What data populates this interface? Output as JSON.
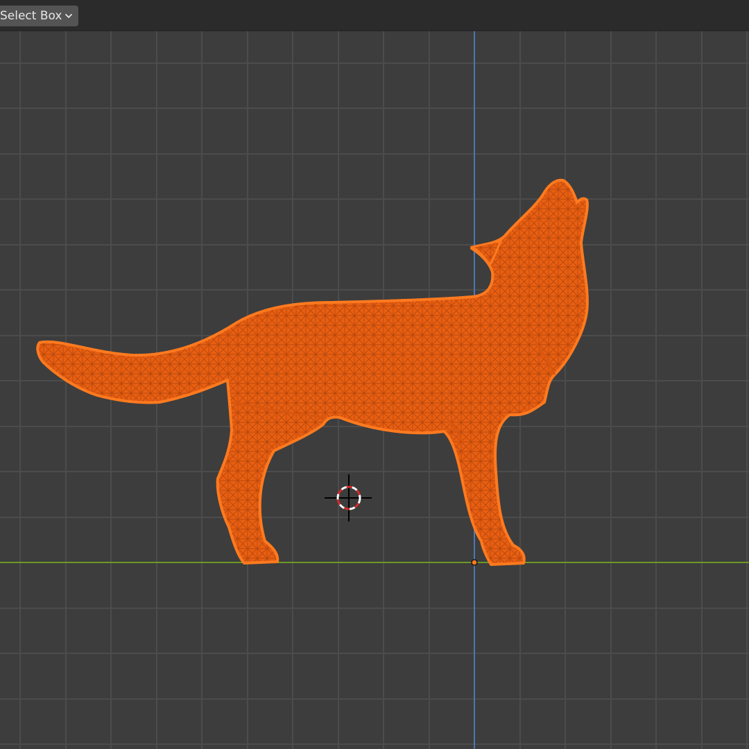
{
  "header": {
    "select_mode_label": "Select Box"
  },
  "icons": {
    "dropdown": "chevron-down-icon",
    "cursor": "3d-cursor-icon",
    "origin": "object-origin-icon"
  },
  "colors": {
    "viewport_bg": "#3d3d3d",
    "grid_line": "#4a4a4a",
    "axis_z": "#4f7fbf",
    "axis_y": "#6a9a2a",
    "selected_mesh": "#ff6a13",
    "wire": "#c24a0c"
  }
}
